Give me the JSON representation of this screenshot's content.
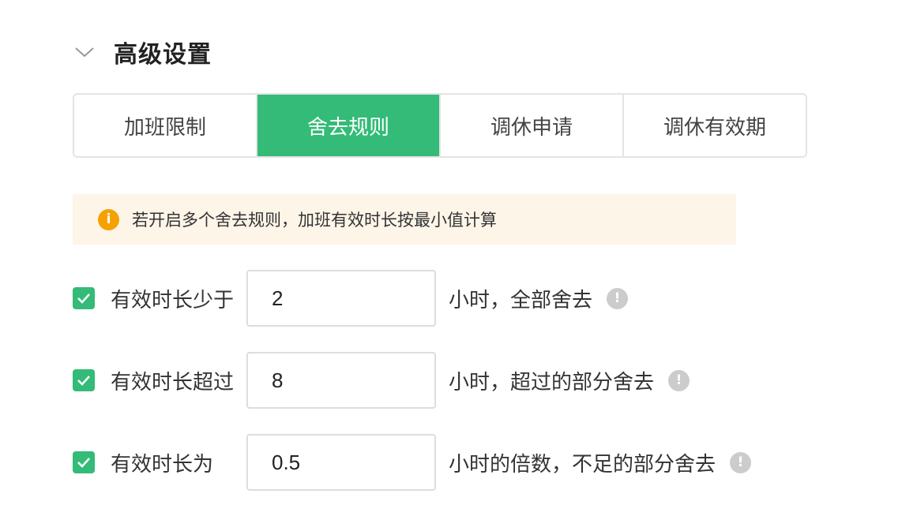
{
  "section": {
    "title": "高级设置",
    "expand_icon": "chevron-down-icon"
  },
  "tabs": [
    {
      "label": "加班限制",
      "active": false
    },
    {
      "label": "舍去规则",
      "active": true
    },
    {
      "label": "调休申请",
      "active": false
    },
    {
      "label": "调休有效期",
      "active": false
    }
  ],
  "notice": {
    "icon": "info-icon",
    "icon_glyph": "i",
    "text": "若开启多个舍去规则，加班有效时长按最小值计算"
  },
  "rules": [
    {
      "checked": true,
      "label": "有效时长少于",
      "value": "2",
      "suffix": "小时，全部舍去",
      "help_glyph": "!"
    },
    {
      "checked": true,
      "label": "有效时长超过",
      "value": "8",
      "suffix": "小时，超过的部分舍去",
      "help_glyph": "!"
    },
    {
      "checked": true,
      "label": "有效时长为",
      "value": "0.5",
      "suffix": "小时的倍数，不足的部分舍去",
      "help_glyph": "!"
    }
  ],
  "colors": {
    "accent": "#33bb77",
    "notice_bg": "#fdf5e8",
    "notice_icon": "#f5a200",
    "help_icon": "#cccccc",
    "border": "#e4e4e4"
  }
}
